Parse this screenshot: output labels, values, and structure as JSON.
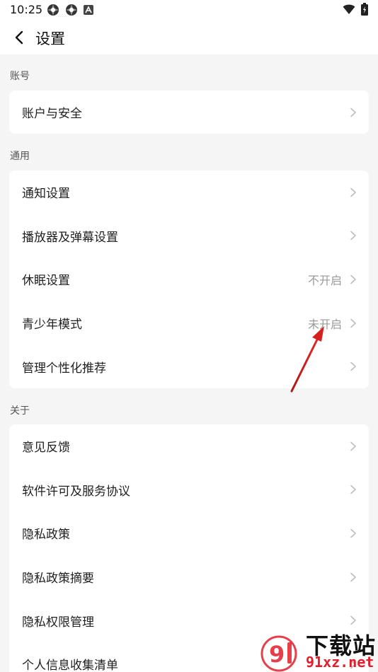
{
  "status_bar": {
    "time": "10:25",
    "left_icons": [
      "app-icon",
      "app-icon",
      "a-icon"
    ],
    "right_icons": [
      "wifi-icon",
      "battery-icon"
    ]
  },
  "appbar": {
    "back_icon": "chevron-left-icon",
    "title": "设置"
  },
  "sections": [
    {
      "header": "账号",
      "items": [
        {
          "label": "账户与安全",
          "value": ""
        }
      ]
    },
    {
      "header": "通用",
      "items": [
        {
          "label": "通知设置",
          "value": ""
        },
        {
          "label": "播放器及弹幕设置",
          "value": ""
        },
        {
          "label": "休眠设置",
          "value": "不开启"
        },
        {
          "label": "青少年模式",
          "value": "未开启"
        },
        {
          "label": "管理个性化推荐",
          "value": ""
        }
      ]
    },
    {
      "header": "关于",
      "items": [
        {
          "label": "意见反馈",
          "value": ""
        },
        {
          "label": "软件许可及服务协议",
          "value": ""
        },
        {
          "label": "隐私政策",
          "value": ""
        },
        {
          "label": "隐私政策摘要",
          "value": ""
        },
        {
          "label": "隐私权限管理",
          "value": ""
        },
        {
          "label": "个人信息收集清单",
          "value": ""
        }
      ]
    }
  ],
  "watermark": {
    "line1": "下载站",
    "line2": "91xz.net"
  },
  "colors": {
    "background": "#f5f5f5",
    "card": "#ffffff",
    "secondary_text": "#9a9a9a",
    "annotation_arrow": "#d62020",
    "watermark_red": "#e01f2d"
  }
}
